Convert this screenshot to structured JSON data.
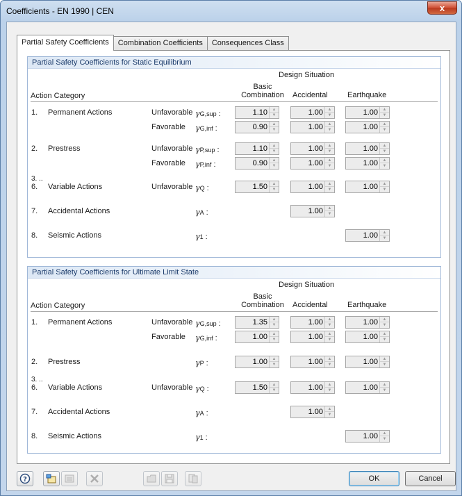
{
  "window": {
    "title": "Coefficients - EN 1990 | CEN",
    "close_glyph": "x"
  },
  "tabs": [
    "Partial Safety Coefficients",
    "Combination Coefficients",
    "Consequences Class"
  ],
  "columns": {
    "action_category": "Action Category",
    "design_situation": "Design Situation",
    "basic_1": "Basic",
    "basic_2": "Combination",
    "accidental": "Accidental",
    "earthquake": "Earthquake"
  },
  "static_equilibrium": {
    "title": "Partial Safety Coefficients for Static Equilibrium",
    "rows": {
      "r1": {
        "num": "1.",
        "label": "Permanent Actions",
        "unfav": {
          "cond": "Unfavorable",
          "sym": "γ",
          "sub": "G,sup",
          "colon": ":",
          "basic": "1.10",
          "acc": "1.00",
          "eq": "1.00"
        },
        "fav": {
          "cond": "Favorable",
          "sym": "γ",
          "sub": "G,inf",
          "colon": ":",
          "basic": "0.90",
          "acc": "1.00",
          "eq": "1.00"
        }
      },
      "r2": {
        "num": "2.",
        "label": "Prestress",
        "unfav": {
          "cond": "Unfavorable",
          "sym": "γ",
          "sub": "P,sup",
          "colon": ":",
          "basic": "1.10",
          "acc": "1.00",
          "eq": "1.00"
        },
        "fav": {
          "cond": "Favorable",
          "sym": "γ",
          "sub": "P,inf",
          "colon": ":",
          "basic": "0.90",
          "acc": "1.00",
          "eq": "1.00"
        }
      },
      "r3": {
        "num_top": "3. ..",
        "num": "6.",
        "label": "Variable Actions",
        "cond": "Unfavorable",
        "sym": "γ",
        "sub": "Q",
        "colon": ":",
        "basic": "1.50",
        "acc": "1.00",
        "eq": "1.00"
      },
      "r7": {
        "num": "7.",
        "label": "Accidental Actions",
        "sym": "γ",
        "sub": "A",
        "colon": ":",
        "acc": "1.00"
      },
      "r8": {
        "num": "8.",
        "label": "Seismic Actions",
        "sym": "γ",
        "sub": "1",
        "colon": ":",
        "eq": "1.00"
      }
    }
  },
  "ultimate_limit": {
    "title": "Partial Safety Coefficients for Ultimate Limit State",
    "rows": {
      "r1": {
        "num": "1.",
        "label": "Permanent Actions",
        "unfav": {
          "cond": "Unfavorable",
          "sym": "γ",
          "sub": "G,sup",
          "colon": ":",
          "basic": "1.35",
          "acc": "1.00",
          "eq": "1.00"
        },
        "fav": {
          "cond": "Favorable",
          "sym": "γ",
          "sub": "G,inf",
          "colon": ":",
          "basic": "1.00",
          "acc": "1.00",
          "eq": "1.00"
        }
      },
      "r2": {
        "num": "2.",
        "label": "Prestress",
        "sym": "γ",
        "sub": "P",
        "colon": ":",
        "basic": "1.00",
        "acc": "1.00",
        "eq": "1.00"
      },
      "r3": {
        "num_top": "3. ..",
        "num": "6.",
        "label": "Variable Actions",
        "cond": "Unfavorable",
        "sym": "γ",
        "sub": "Q",
        "colon": ":",
        "basic": "1.50",
        "acc": "1.00",
        "eq": "1.00"
      },
      "r7": {
        "num": "7.",
        "label": "Accidental Actions",
        "sym": "γ",
        "sub": "A",
        "colon": ":",
        "acc": "1.00"
      },
      "r8": {
        "num": "8.",
        "label": "Seismic Actions",
        "sym": "γ",
        "sub": "1",
        "colon": ":",
        "eq": "1.00"
      }
    }
  },
  "buttons": {
    "ok": "OK",
    "cancel": "Cancel"
  },
  "toolbar_icons": [
    "help-icon",
    "new-icon",
    "edit-icon",
    "delete-icon",
    "load-icon",
    "save-icon",
    "defaults-icon"
  ]
}
